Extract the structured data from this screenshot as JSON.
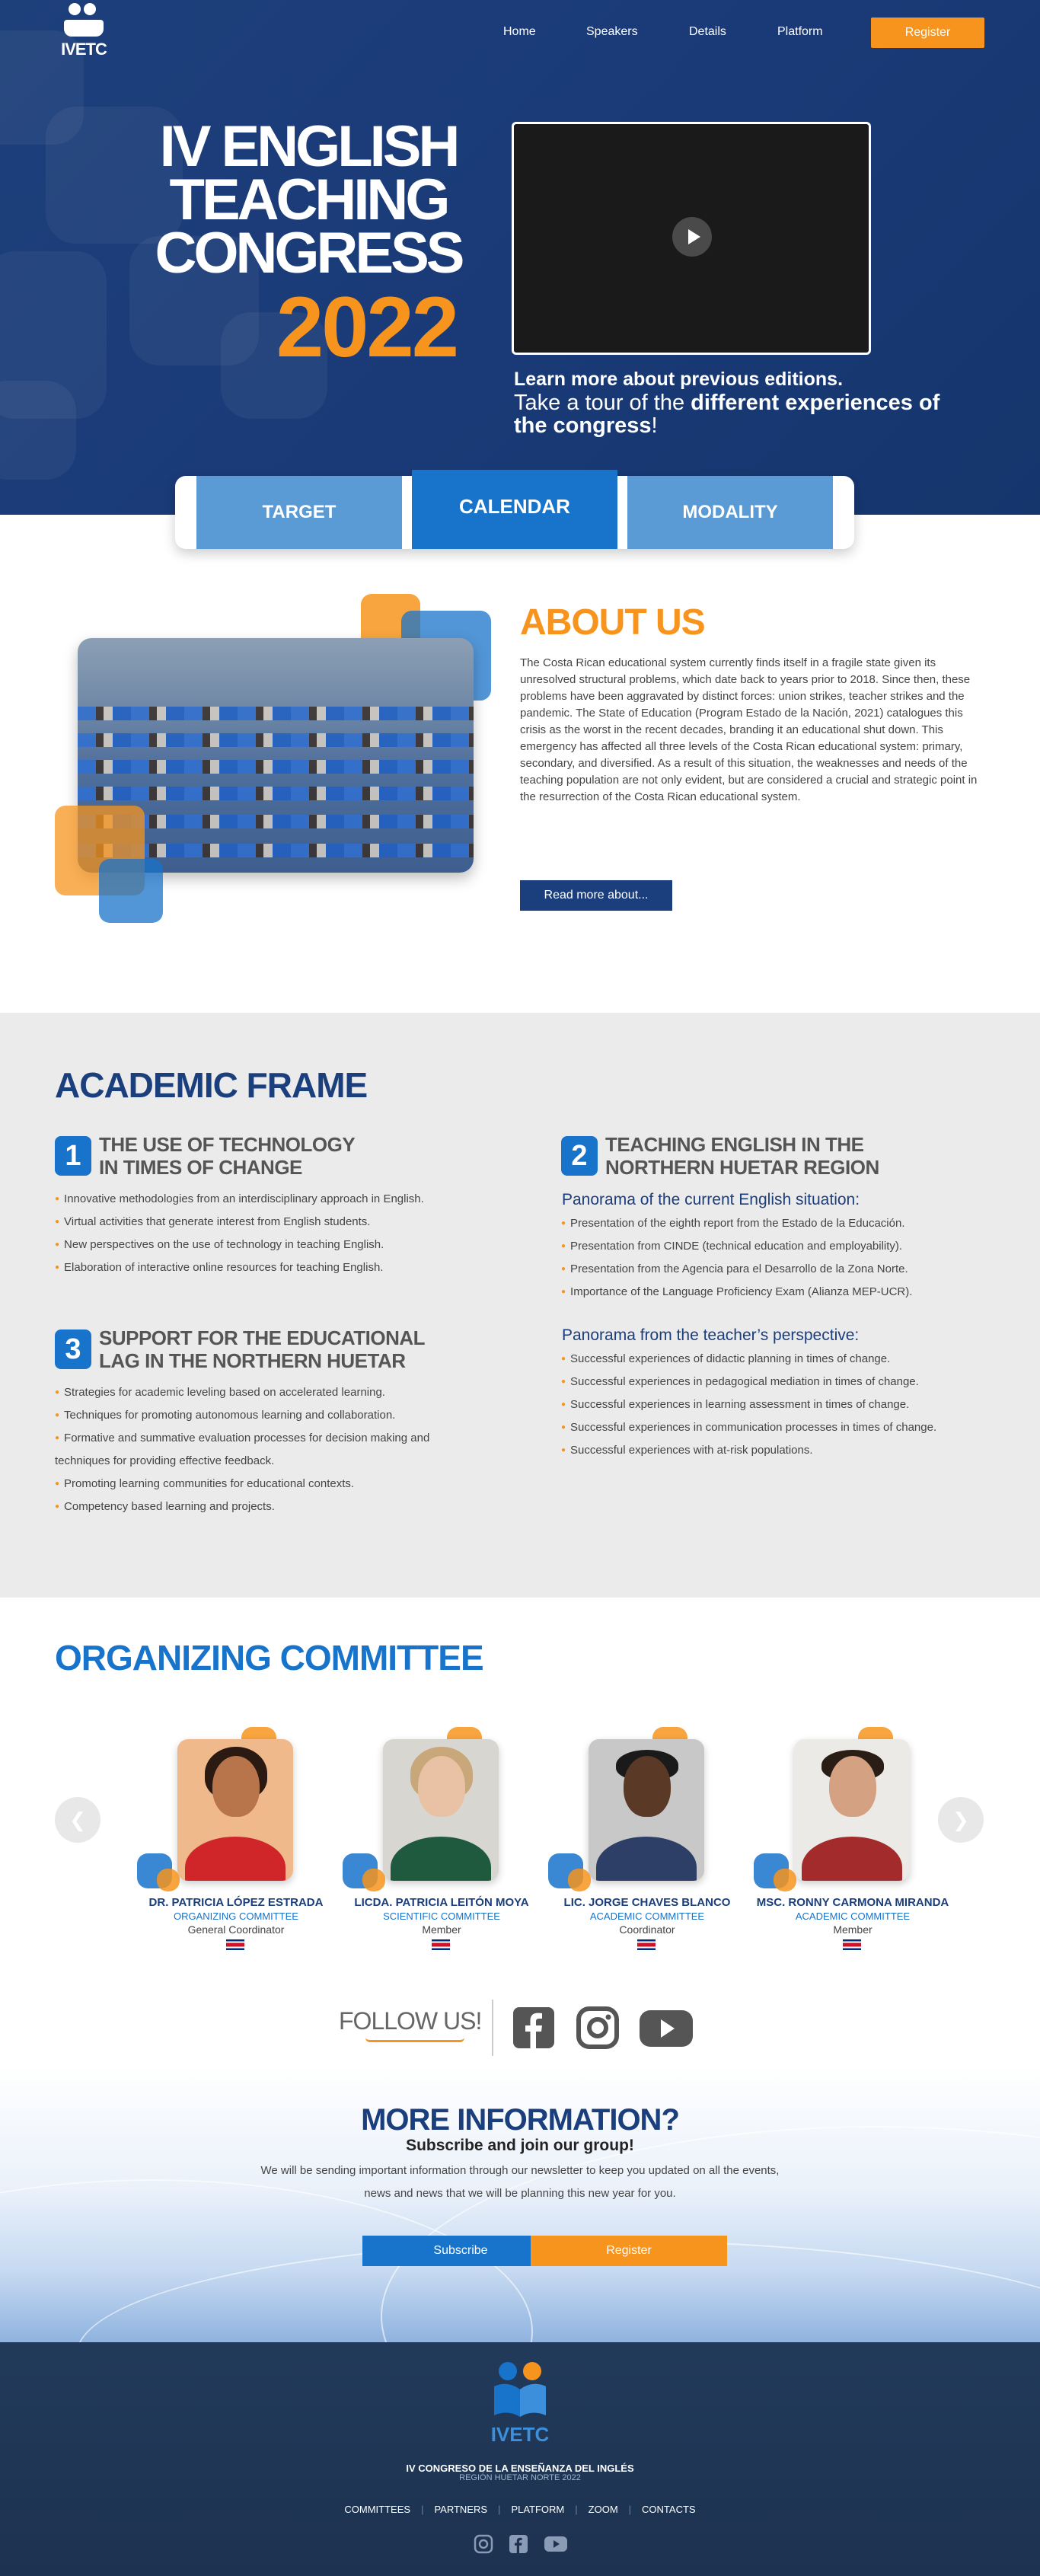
{
  "nav": {
    "logo_text": "IVETC",
    "links": [
      "Home",
      "Speakers",
      "Details",
      "Platform"
    ],
    "register": "Register"
  },
  "hero": {
    "title_lines": [
      "IV ENGLISH",
      "TEACHING",
      "CONGRESS"
    ],
    "year": "2022",
    "learn_more": "Learn more about previous editions.",
    "tour_prefix": "Take a tour of the ",
    "tour_bold": "different experiences of the congress",
    "tour_suffix": "!"
  },
  "tabs": [
    "TARGET",
    "CALENDAR",
    "MODALITY"
  ],
  "about": {
    "title": "ABOUT US",
    "text": "The Costa Rican educational system currently finds itself in a fragile state given its unresolved structural problems, which date back to years prior to 2018.  Since then, these problems have been aggravated by distinct forces: union strikes, teacher strikes and the pandemic. The State of Education (Program Estado de la Nación, 2021)  catalogues this crisis as the worst in the recent decades, branding it an educational shut down. This emergency has affected all three levels of the Costa Rican educational system: primary, secondary, and diversified. As a result of this situation, the weaknesses and needs of the teaching population are not only evident, but are considered a crucial and strategic point in the resurrection of the Costa Rican educational system.",
    "button": "Read more about..."
  },
  "academic": {
    "title": "ACADEMIC FRAME",
    "blocks": [
      {
        "num": "1",
        "title_lines": [
          "THE USE OF TECHNOLOGY",
          "IN TIMES OF CHANGE"
        ],
        "items": [
          "Innovative methodologies from an interdisciplinary approach in English.",
          "Virtual activities that generate interest from English students.",
          "New perspectives on the use of technology in teaching English.",
          "Elaboration of interactive online resources for teaching English."
        ]
      },
      {
        "num": "2",
        "title_lines": [
          "TEACHING ENGLISH IN THE",
          "NORTHERN HUETAR REGION"
        ],
        "sub1": "Panorama of the current English situation:",
        "items1": [
          "Presentation of the eighth report from the Estado de la Educación.",
          "Presentation from CINDE (technical education and employability).",
          "Presentation from the Agencia para el Desarrollo de la Zona Norte.",
          "Importance of the Language Proficiency Exam (Alianza MEP-UCR)."
        ],
        "sub2": "Panorama from the teacher’s perspective:",
        "items2": [
          "Successful experiences of didactic planning in times of change.",
          "Successful experiences in pedagogical mediation in times of change.",
          "Successful experiences in learning assessment in times of change.",
          "Successful experiences in communication processes in times of change.",
          "Successful experiences with at-risk populations."
        ]
      },
      {
        "num": "3",
        "title_lines": [
          "SUPPORT FOR THE EDUCATIONAL",
          "LAG IN THE NORTHERN HUETAR"
        ],
        "items": [
          "Strategies for academic leveling based on accelerated learning.",
          "Techniques for promoting autonomous learning and collaboration.",
          "Formative and summative evaluation processes for decision making and techniques for providing effective feedback.",
          "Promoting learning communities for educational contexts.",
          "Competency based learning and projects."
        ]
      }
    ]
  },
  "committee": {
    "title": "ORGANIZING COMMITTEE",
    "members": [
      {
        "name": "DR. PATRICIA LÓPEZ ESTRADA",
        "role": "ORGANIZING COMMITTEE",
        "position": "General Coordinator"
      },
      {
        "name": "LICDA. PATRICIA LEITÓN MOYA",
        "role": "SCIENTIFIC COMMITTEE",
        "position": "Member"
      },
      {
        "name": "LIC. JORGE CHAVES BLANCO",
        "role": "ACADEMIC COMMITTEE",
        "position": "Coordinator"
      },
      {
        "name": "MSC. RONNY CARMONA MIRANDA",
        "role": "ACADEMIC COMMITTEE",
        "position": "Member"
      }
    ]
  },
  "follow": {
    "label": "FOLLOW US!"
  },
  "more": {
    "title": "MORE INFORMATION?",
    "subtitle": "Subscribe and join our group!",
    "text": "We will be sending important information through our newsletter to keep you updated on all the events, news and news that we will be planning this new year for you.",
    "subscribe": "Subscribe",
    "register": "Register"
  },
  "footer": {
    "logo_text": "IVETC",
    "line1": "IV CONGRESO DE LA ENSEÑANZA DEL INGLÉS",
    "line2": "REGIÓN HUETAR NORTE 2022",
    "links": [
      "COMMITTEES",
      "PARTNERS",
      "PLATFORM",
      "ZOOM",
      "CONTACTS"
    ]
  },
  "colors": {
    "navy": "#1b3e7c",
    "blue": "#1873cb",
    "light_blue": "#5a9bd5",
    "orange": "#f7941d"
  }
}
